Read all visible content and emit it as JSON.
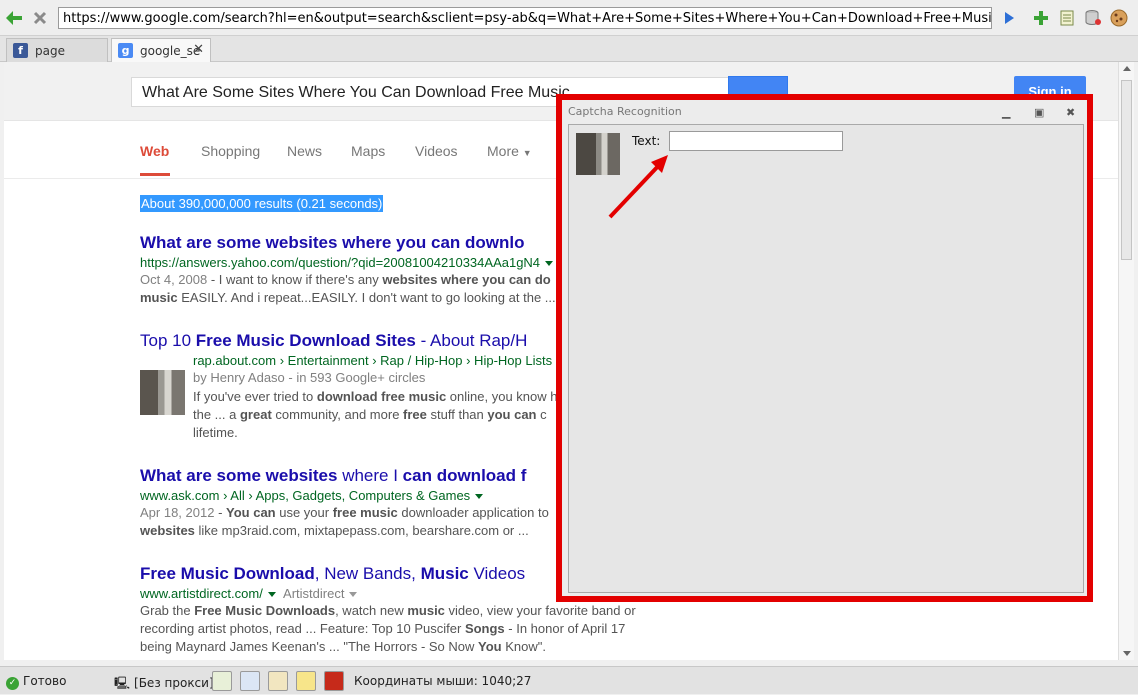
{
  "browser": {
    "url": "https://www.google.com/search?hl=en&output=search&sclient=psy-ab&q=What+Are+Some+Sites+Where+You+Can+Download+Free+Music&oq=What+Are+...",
    "tabs": [
      {
        "label": "page",
        "icon": "facebook-icon",
        "active": false
      },
      {
        "label": "google_se",
        "icon": "google-icon",
        "active": true
      }
    ]
  },
  "google": {
    "query": "What Are Some Sites Where You Can Download Free Music",
    "signin_label": "Sign in",
    "tabs": [
      "Web",
      "Shopping",
      "News",
      "Maps",
      "Videos",
      "More"
    ],
    "stats": "About 390,000,000 results (0.21 seconds)",
    "results": [
      {
        "title": "What are some websites where you can downlo",
        "url": "https://answers.yahoo.com/question/?qid=20081004210334AAa1gN4",
        "date": "Oct 4, 2008",
        "snippet_1": " - I want to know if there's any ",
        "snippet_1b": "websites where you can do",
        "snippet_2a": "music",
        "snippet_2b": " EASILY. And i repeat...EASILY. I don't want to go looking at the ..."
      },
      {
        "title_pre": "Top 10 ",
        "title_bold": "Free Music Download Sites",
        "title_post": " - About Rap/H",
        "url": "rap.about.com › Entertainment › Rap / Hip-Hop › Hip-Hop Lists",
        "author": "by Henry Adaso - in 593 Google+ circles",
        "s1a": "If you've ever tried to ",
        "s1b": "download free music",
        "s1c": " online, you know h",
        "s2a": "the ... a ",
        "s2b": "great",
        "s2c": " community, and more ",
        "s2d": "free",
        "s2e": " stuff than ",
        "s2f": "you can",
        "s2g": " c",
        "s3": "lifetime."
      },
      {
        "title_bold": "What are some websites",
        "title_mid": " where I ",
        "title_bold2": "can download f",
        "url": "www.ask.com › All › Apps, Gadgets, Computers & Games",
        "date": "Apr 18, 2012",
        "s1a": " - ",
        "s1b": "You can",
        "s1c": " use your ",
        "s1d": "free music",
        "s1e": " downloader application to ",
        "s2a": "websites",
        "s2b": " like mp3raid.com, mixtapepass.com, bearshare.com or ..."
      },
      {
        "title_bold": "Free Music Download",
        "title_mid": ", New Bands, ",
        "title_bold2": "Music",
        "title_post": " Videos ",
        "url": "www.artistdirect.com/",
        "source": "Artistdirect",
        "s1a": "Grab the ",
        "s1b": "Free Music Downloads",
        "s1c": ", watch new ",
        "s1d": "music",
        "s1e": " video, view your favorite band or",
        "s2a": "recording artist photos, read ... Feature: Top 10 Puscifer ",
        "s2b": "Songs",
        "s2c": " - In honor of April 17",
        "s3a": "being Maynard James Keenan's ... \"The Horrors - So Now ",
        "s3b": "You",
        "s3c": " Know\"."
      }
    ]
  },
  "captcha": {
    "title": "Captcha Recognition",
    "label": "Text:",
    "value": "",
    "highlight_color": "#e30000"
  },
  "status": {
    "ready": "Готово",
    "proxy": "[Без прокси]",
    "mouse": "Координаты мыши: 1040;27"
  }
}
